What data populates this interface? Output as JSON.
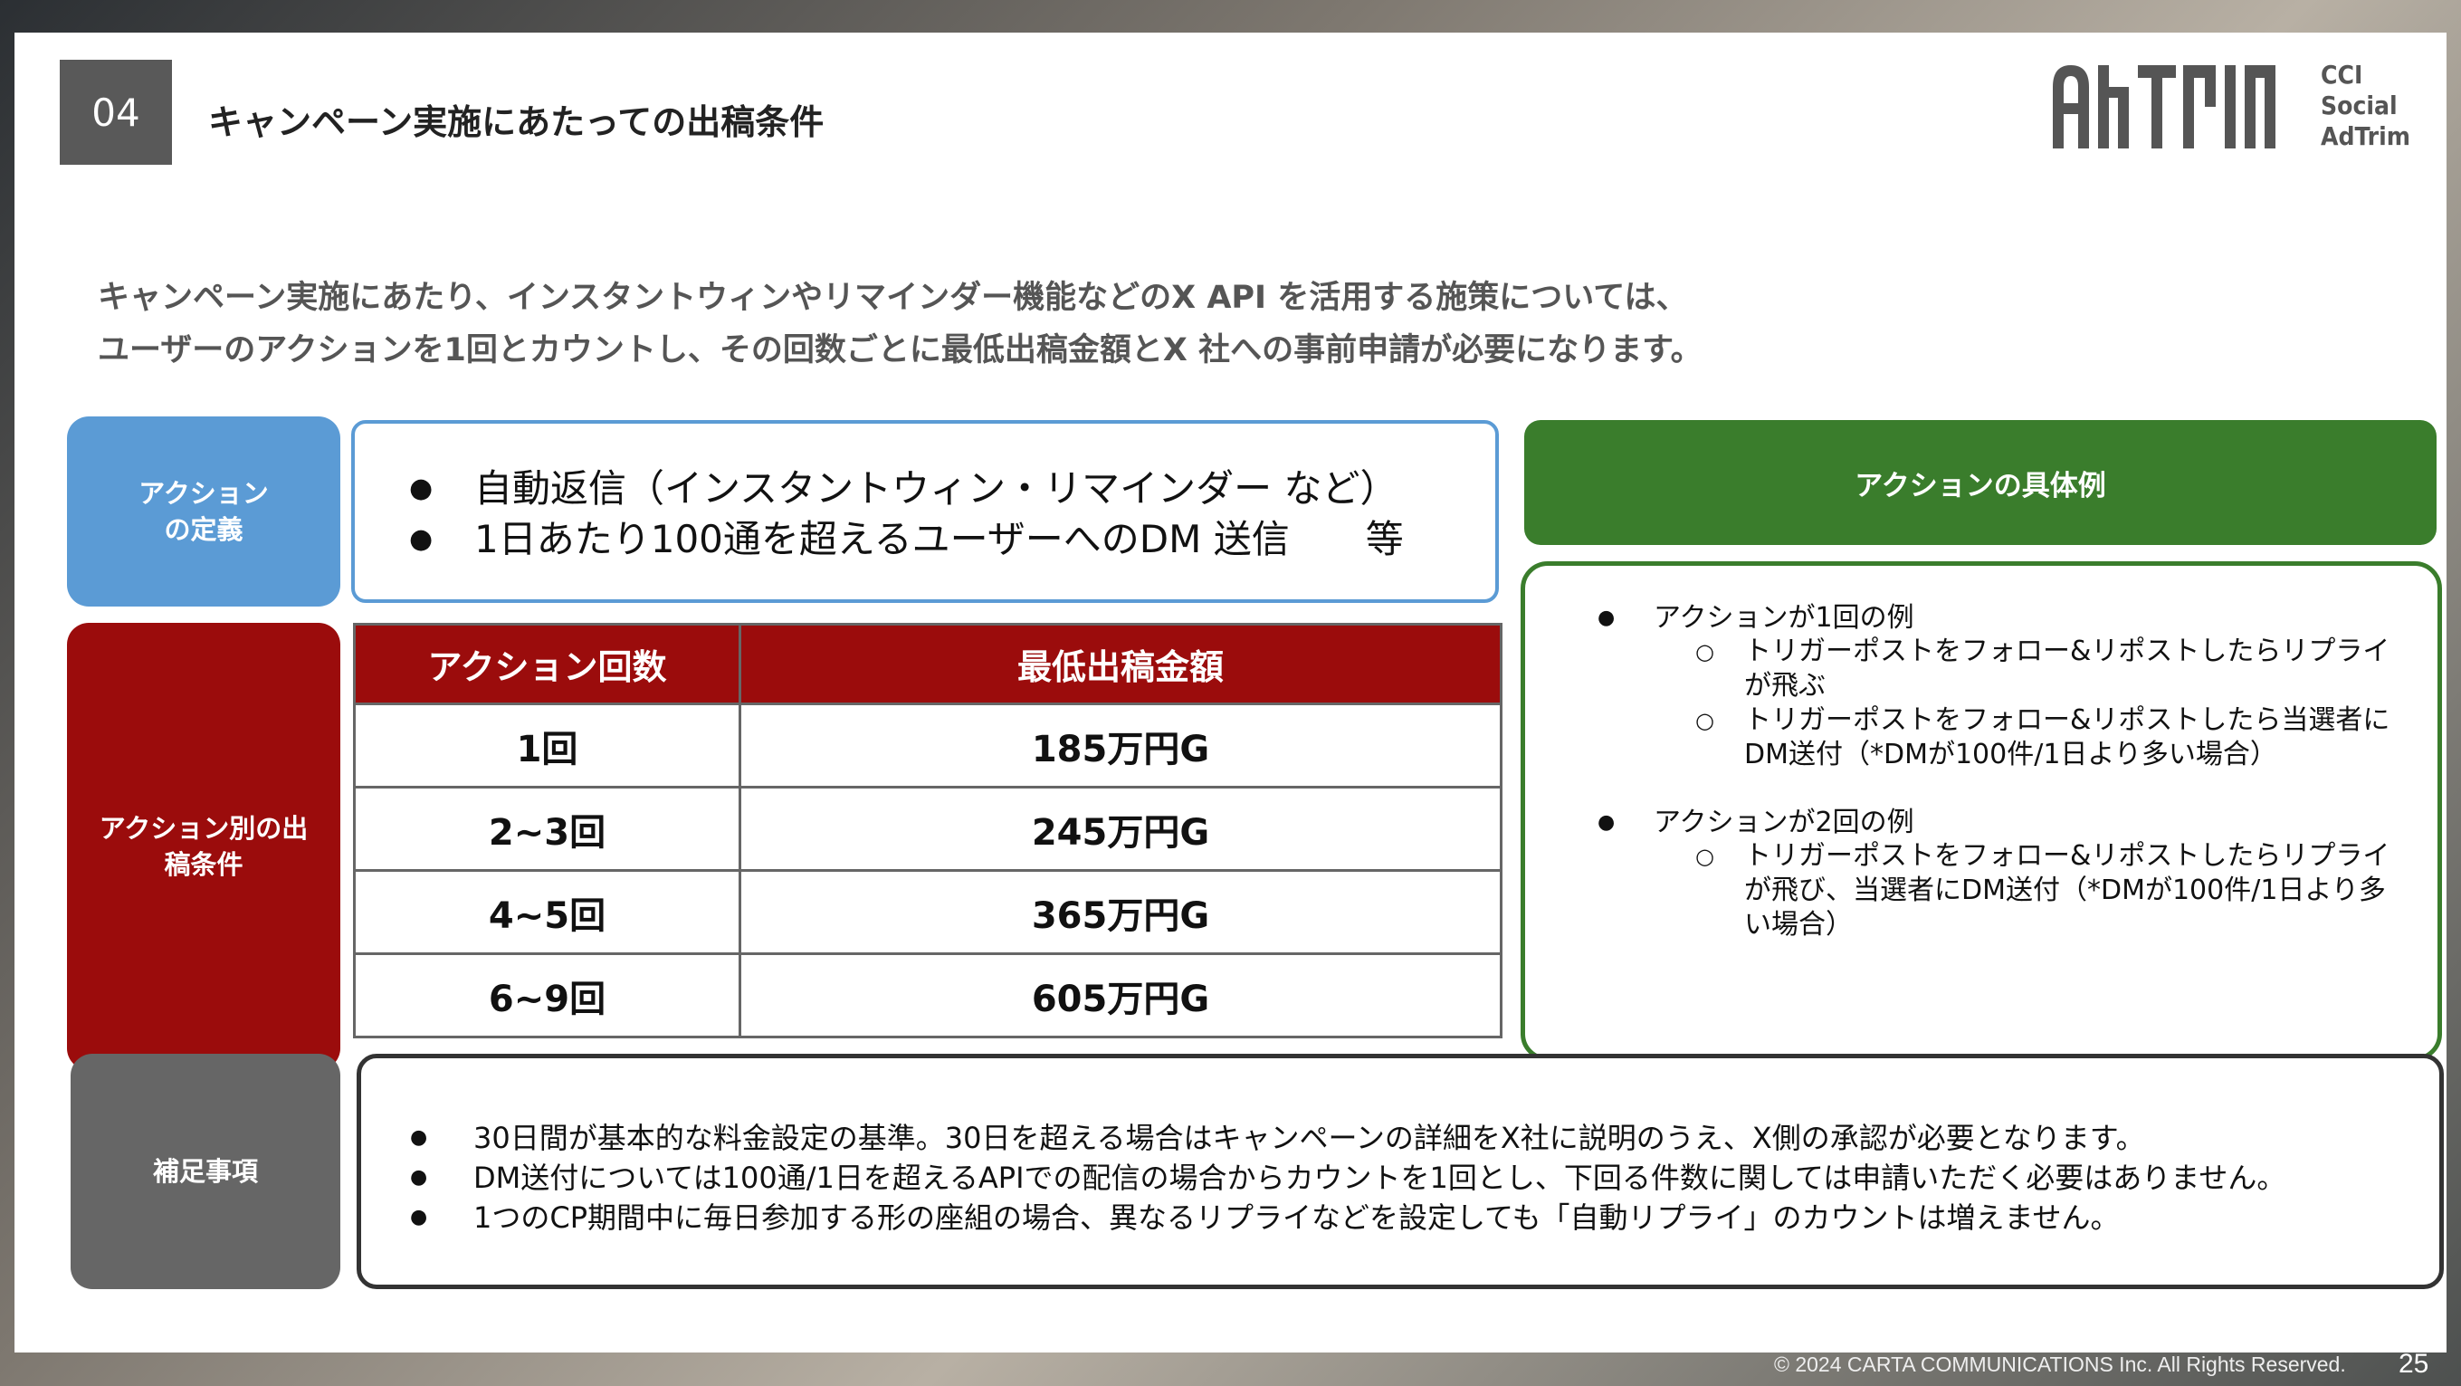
{
  "header": {
    "section_number": "04",
    "title": "キャンペーン実施にあたっての出稿条件"
  },
  "logo": {
    "line1": "CCI",
    "line2": "Social",
    "line3": "AdTrim"
  },
  "intro": {
    "line1": "キャンペーン実施にあたり、インスタントウィンやリマインダー機能などのX API を活用する施策については、",
    "line2": "ユーザーのアクションを1回とカウントし、その回数ごとに最低出稿金額とX 社への事前申請が必要になります。"
  },
  "definition": {
    "label_line1": "アクション",
    "label_line2": "の定義",
    "items": [
      "自動返信（インスタントウィン・リマインダー など）",
      "1日あたり100通を超えるユーザーへのDM 送信　　等"
    ]
  },
  "conditions": {
    "label_line1": "アクション別の出",
    "label_line2": "稿条件",
    "headers": [
      "アクション回数",
      "最低出稿金額"
    ],
    "rows": [
      [
        "1回",
        "185万円G"
      ],
      [
        "2~3回",
        "245万円G"
      ],
      [
        "4~5回",
        "365万円G"
      ],
      [
        "6~9回",
        "605万円G"
      ]
    ]
  },
  "examples": {
    "header": "アクションの具体例",
    "group1": {
      "title": "アクションが1回の例",
      "items": [
        "トリガーポストをフォロー&リポストしたらリプライが飛ぶ",
        "トリガーポストをフォロー&リポストしたら当選者にDM送付（*DMが100件/1日より多い場合）"
      ]
    },
    "group2": {
      "title": "アクションが2回の例",
      "items": [
        "トリガーポストをフォロー&リポストしたらリプライが飛び、当選者にDM送付（*DMが100件/1日より多い場合）"
      ]
    }
  },
  "notes": {
    "label": "補足事項",
    "items": [
      "30日間が基本的な料金設定の基準。30日を超える場合はキャンペーンの詳細をX社に説明のうえ、X側の承認が必要となります。",
      "DM送付については100通/1日を超えるAPIでの配信の場合からカウントを1回とし、下回る件数に関しては申請いただく必要はありません。",
      "1つのCP期間中に毎日参加する形の座組の場合、異なるリプライなどを設定しても「自動リプライ」のカウントは増えません。"
    ]
  },
  "footer": {
    "copyright": "© 2024 CARTA COMMUNICATIONS Inc.  All Rights Reserved.",
    "page": "25"
  },
  "colors": {
    "blue": "#5b9bd5",
    "red": "#9b0c0c",
    "green": "#3a7d2c",
    "gray": "#666666"
  }
}
